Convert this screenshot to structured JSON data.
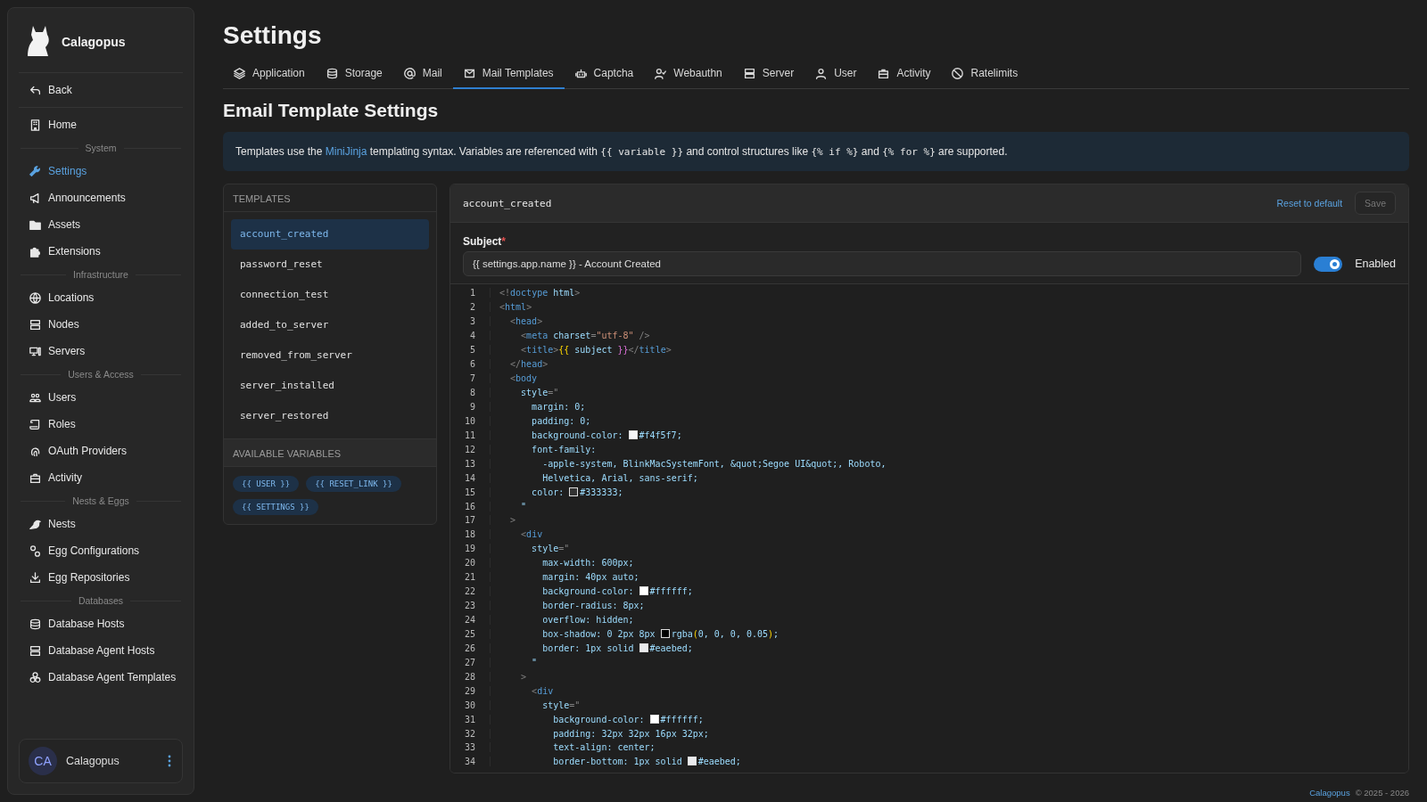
{
  "brand": {
    "name": "Calagopus"
  },
  "sidebar": {
    "top_items": [
      {
        "label": "Back",
        "selected": false
      },
      {
        "label": "Home",
        "selected": false
      }
    ],
    "groups": [
      {
        "heading": "System",
        "items": [
          {
            "label": "Settings",
            "selected": true
          },
          {
            "label": "Announcements",
            "selected": false
          },
          {
            "label": "Assets",
            "selected": false
          },
          {
            "label": "Extensions",
            "selected": false
          }
        ]
      },
      {
        "heading": "Infrastructure",
        "items": [
          {
            "label": "Locations",
            "selected": false
          },
          {
            "label": "Nodes",
            "selected": false
          },
          {
            "label": "Servers",
            "selected": false
          }
        ]
      },
      {
        "heading": "Users & Access",
        "items": [
          {
            "label": "Users",
            "selected": false
          },
          {
            "label": "Roles",
            "selected": false
          },
          {
            "label": "OAuth Providers",
            "selected": false
          },
          {
            "label": "Activity",
            "selected": false
          }
        ]
      },
      {
        "heading": "Nests & Eggs",
        "items": [
          {
            "label": "Nests",
            "selected": false
          },
          {
            "label": "Egg Configurations",
            "selected": false
          },
          {
            "label": "Egg Repositories",
            "selected": false
          }
        ]
      },
      {
        "heading": "Databases",
        "items": [
          {
            "label": "Database Hosts",
            "selected": false
          },
          {
            "label": "Database Agent Hosts",
            "selected": false
          },
          {
            "label": "Database Agent Templates",
            "selected": false
          }
        ]
      }
    ]
  },
  "user": {
    "initials": "CA",
    "name": "Calagopus"
  },
  "page_title": "Settings",
  "tabs": [
    {
      "label": "Application",
      "selected": false
    },
    {
      "label": "Storage",
      "selected": false
    },
    {
      "label": "Mail",
      "selected": false
    },
    {
      "label": "Mail Templates",
      "selected": true
    },
    {
      "label": "Captcha",
      "selected": false
    },
    {
      "label": "Webauthn",
      "selected": false
    },
    {
      "label": "Server",
      "selected": false
    },
    {
      "label": "User",
      "selected": false
    },
    {
      "label": "Activity",
      "selected": false
    },
    {
      "label": "Ratelimits",
      "selected": false
    }
  ],
  "section_title": "Email Template Settings",
  "info": [
    {
      "kind": "text",
      "text": "Templates use the "
    },
    {
      "kind": "link",
      "text": "MiniJinja"
    },
    {
      "kind": "text",
      "text": " templating syntax. Variables are referenced with "
    },
    {
      "kind": "code",
      "text": "{{ variable }}"
    },
    {
      "kind": "text",
      "text": " and control structures like "
    },
    {
      "kind": "code",
      "text": "{% if %}"
    },
    {
      "kind": "text",
      "text": " and "
    },
    {
      "kind": "code",
      "text": "{% for %}"
    },
    {
      "kind": "text",
      "text": " are supported."
    }
  ],
  "templates": {
    "heading": "TEMPLATES",
    "items": [
      {
        "label": "account_created",
        "selected": true
      },
      {
        "label": "password_reset",
        "selected": false
      },
      {
        "label": "connection_test",
        "selected": false
      },
      {
        "label": "added_to_server",
        "selected": false
      },
      {
        "label": "removed_from_server",
        "selected": false
      },
      {
        "label": "server_installed",
        "selected": false
      },
      {
        "label": "server_restored",
        "selected": false
      }
    ]
  },
  "variables": {
    "heading": "AVAILABLE VARIABLES",
    "items": [
      "{{ USER }}",
      "{{ RESET_LINK }}",
      "{{ SETTINGS }}"
    ]
  },
  "editor": {
    "name": "account_created",
    "reset": "Reset to default",
    "save": {
      "label": "Save",
      "disabled": true
    },
    "subject": {
      "label": "Subject",
      "required_mark": "*",
      "value": "{{ settings.app.name }} - Account Created"
    },
    "enabled": {
      "label": "Enabled",
      "on": true
    },
    "code": [
      {
        "n": "1",
        "tokens": [
          {
            "kind": "punct",
            "text": "<!"
          },
          {
            "kind": "tag",
            "text": "doctype"
          },
          {
            "kind": "attr",
            "text": " html"
          },
          {
            "kind": "punct",
            "text": ">"
          }
        ]
      },
      {
        "n": "2",
        "tokens": [
          {
            "kind": "punct",
            "text": "<"
          },
          {
            "kind": "tag",
            "text": "html"
          },
          {
            "kind": "punct",
            "text": ">"
          }
        ]
      },
      {
        "n": "3",
        "tokens": [
          {
            "kind": "punct",
            "text": "  <"
          },
          {
            "kind": "tag",
            "text": "head"
          },
          {
            "kind": "punct",
            "text": ">"
          }
        ]
      },
      {
        "n": "4",
        "tokens": [
          {
            "kind": "punct",
            "text": "    <"
          },
          {
            "kind": "tag",
            "text": "meta"
          },
          {
            "kind": "attr",
            "text": " charset"
          },
          {
            "kind": "punct",
            "text": "="
          },
          {
            "kind": "str",
            "text": "\"utf-8\""
          },
          {
            "kind": "punct",
            "text": " />"
          }
        ]
      },
      {
        "n": "5",
        "tokens": [
          {
            "kind": "punct",
            "text": "    <"
          },
          {
            "kind": "tag",
            "text": "title"
          },
          {
            "kind": "punct",
            "text": ">"
          },
          {
            "kind": "brace",
            "text": "{{"
          },
          {
            "kind": "css",
            "text": " subject "
          },
          {
            "kind": "brace2",
            "text": "}}"
          },
          {
            "kind": "punct",
            "text": "</"
          },
          {
            "kind": "tag",
            "text": "title"
          },
          {
            "kind": "punct",
            "text": ">"
          }
        ]
      },
      {
        "n": "6",
        "tokens": [
          {
            "kind": "punct",
            "text": "  </"
          },
          {
            "kind": "tag",
            "text": "head"
          },
          {
            "kind": "punct",
            "text": ">"
          }
        ]
      },
      {
        "n": "7",
        "tokens": [
          {
            "kind": "punct",
            "text": "  <"
          },
          {
            "kind": "tag",
            "text": "body"
          }
        ]
      },
      {
        "n": "8",
        "tokens": [
          {
            "kind": "attr",
            "text": "    style"
          },
          {
            "kind": "punct",
            "text": "=\""
          }
        ]
      },
      {
        "n": "9",
        "tokens": [
          {
            "kind": "css",
            "text": "      margin: 0;"
          }
        ]
      },
      {
        "n": "10",
        "tokens": [
          {
            "kind": "css",
            "text": "      padding: 0;"
          }
        ]
      },
      {
        "n": "11",
        "tokens": [
          {
            "kind": "css",
            "text": "      background-color: "
          },
          {
            "kind": "swatch",
            "color": "#f4f5f7"
          },
          {
            "kind": "css",
            "text": "#f4f5f7;"
          }
        ]
      },
      {
        "n": "12",
        "tokens": [
          {
            "kind": "css",
            "text": "      font-family:"
          }
        ]
      },
      {
        "n": "13",
        "tokens": [
          {
            "kind": "css",
            "text": "        -apple-system, BlinkMacSystemFont, &quot;Segoe UI&quot;, Roboto,"
          }
        ]
      },
      {
        "n": "14",
        "tokens": [
          {
            "kind": "css",
            "text": "        Helvetica, Arial, sans-serif;"
          }
        ]
      },
      {
        "n": "15",
        "tokens": [
          {
            "kind": "css",
            "text": "      color: "
          },
          {
            "kind": "swatch",
            "color": "#333333"
          },
          {
            "kind": "css",
            "text": "#333333;"
          }
        ]
      },
      {
        "n": "16",
        "tokens": [
          {
            "kind": "css",
            "text": "    \""
          }
        ]
      },
      {
        "n": "17",
        "tokens": [
          {
            "kind": "punct",
            "text": "  >"
          }
        ]
      },
      {
        "n": "18",
        "tokens": [
          {
            "kind": "punct",
            "text": "    <"
          },
          {
            "kind": "tag",
            "text": "div"
          }
        ]
      },
      {
        "n": "19",
        "tokens": [
          {
            "kind": "attr",
            "text": "      style"
          },
          {
            "kind": "punct",
            "text": "=\""
          }
        ]
      },
      {
        "n": "20",
        "tokens": [
          {
            "kind": "css",
            "text": "        max-width: 600px;"
          }
        ]
      },
      {
        "n": "21",
        "tokens": [
          {
            "kind": "css",
            "text": "        margin: 40px auto;"
          }
        ]
      },
      {
        "n": "22",
        "tokens": [
          {
            "kind": "css",
            "text": "        background-color: "
          },
          {
            "kind": "swatch",
            "color": "#ffffff"
          },
          {
            "kind": "css",
            "text": "#ffffff;"
          }
        ]
      },
      {
        "n": "23",
        "tokens": [
          {
            "kind": "css",
            "text": "        border-radius: 8px;"
          }
        ]
      },
      {
        "n": "24",
        "tokens": [
          {
            "kind": "css",
            "text": "        overflow: hidden;"
          }
        ]
      },
      {
        "n": "25",
        "tokens": [
          {
            "kind": "css",
            "text": "        box-shadow: 0 2px 8px "
          },
          {
            "kind": "swatch",
            "color": "#000000"
          },
          {
            "kind": "css",
            "text": "rgba"
          },
          {
            "kind": "brace",
            "text": "("
          },
          {
            "kind": "css",
            "text": "0, 0, 0, 0.05"
          },
          {
            "kind": "brace",
            "text": ")"
          },
          {
            "kind": "css",
            "text": ";"
          }
        ]
      },
      {
        "n": "26",
        "tokens": [
          {
            "kind": "css",
            "text": "        border: 1px solid "
          },
          {
            "kind": "swatch",
            "color": "#eaebed"
          },
          {
            "kind": "css",
            "text": "#eaebed;"
          }
        ]
      },
      {
        "n": "27",
        "tokens": [
          {
            "kind": "css",
            "text": "      \""
          }
        ]
      },
      {
        "n": "28",
        "tokens": [
          {
            "kind": "punct",
            "text": "    >"
          }
        ]
      },
      {
        "n": "29",
        "tokens": [
          {
            "kind": "punct",
            "text": "      <"
          },
          {
            "kind": "tag",
            "text": "div"
          }
        ]
      },
      {
        "n": "30",
        "tokens": [
          {
            "kind": "attr",
            "text": "        style"
          },
          {
            "kind": "punct",
            "text": "=\""
          }
        ]
      },
      {
        "n": "31",
        "tokens": [
          {
            "kind": "css",
            "text": "          background-color: "
          },
          {
            "kind": "swatch",
            "color": "#ffffff"
          },
          {
            "kind": "css",
            "text": "#ffffff;"
          }
        ]
      },
      {
        "n": "32",
        "tokens": [
          {
            "kind": "css",
            "text": "          padding: 32px 32px 16px 32px;"
          }
        ]
      },
      {
        "n": "33",
        "tokens": [
          {
            "kind": "css",
            "text": "          text-align: center;"
          }
        ]
      },
      {
        "n": "34",
        "tokens": [
          {
            "kind": "css",
            "text": "          border-bottom: 1px solid "
          },
          {
            "kind": "swatch",
            "color": "#eaebed"
          },
          {
            "kind": "css",
            "text": "#eaebed;"
          }
        ]
      }
    ]
  },
  "footer": {
    "link": "Calagopus",
    "text": "© 2025 - 2026"
  }
}
